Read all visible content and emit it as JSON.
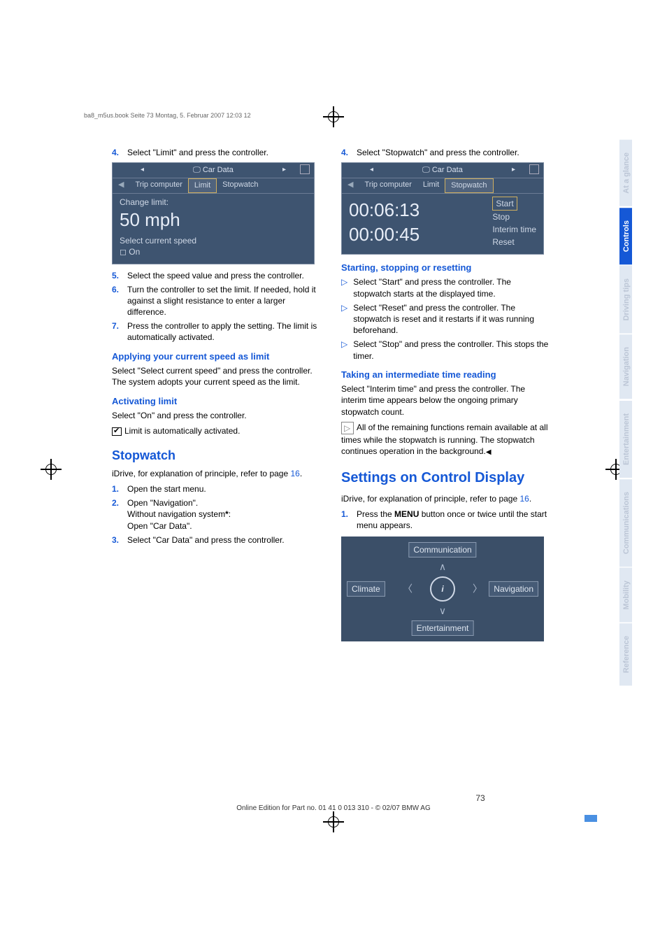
{
  "header_running": "ba8_m5us.book  Seite 73  Montag, 5. Februar 2007  12:03 12",
  "left": {
    "step4": "Select \"Limit\" and press the controller.",
    "shot1": {
      "title": "Car Data",
      "tab1": "Trip computer",
      "tab2": "Limit",
      "tab3": "Stopwatch",
      "line1": "Change limit:",
      "big": "50 mph",
      "line2": "Select current speed",
      "line3": "On"
    },
    "step5": "Select the speed value and press the controller.",
    "step6": "Turn the controller to set the limit. If needed, hold it against a slight resistance to enter a larger difference.",
    "step7": "Press the controller to apply the setting. The limit is automatically activated.",
    "h_apply": "Applying your current speed as limit",
    "p_apply": "Select \"Select current speed\" and press the controller. The system adopts your current speed as the limit.",
    "h_act": "Activating limit",
    "p_act1": "Select \"On\" and press the controller.",
    "p_act2": "Limit is automatically activated.",
    "h_stopwatch": "Stopwatch",
    "p_idrive": "iDrive, for explanation of principle, refer to page ",
    "pglink": "16",
    "s1": "Open the start menu.",
    "s2a": "Open \"Navigation\".",
    "s2b": "Without navigation system",
    "s2c": "Open \"Car Data\".",
    "s3": "Select \"Car Data\" and press the controller."
  },
  "right": {
    "step4": "Select \"Stopwatch\" and press the controller.",
    "shot2": {
      "title": "Car Data",
      "tab1": "Trip computer",
      "tab2": "Limit",
      "tab3": "Stopwatch",
      "t1": "00:06:13",
      "t2": "00:00:45",
      "o1": "Start",
      "o2": "Stop",
      "o3": "Interim time",
      "o4": "Reset"
    },
    "h_start": "Starting, stopping or resetting",
    "b1": "Select \"Start\" and press the controller. The stopwatch starts at the displayed time.",
    "b2": "Select \"Reset\" and press the controller. The stopwatch is reset and it restarts if it was running beforehand.",
    "b3": "Select \"Stop\" and press the controller. This stops the timer.",
    "h_interim": "Taking an intermediate time reading",
    "p_interim": "Select \"Interim time\" and press the controller. The interim time appears below the ongoing primary stopwatch count.",
    "note": "All of the remaining functions remain available at all times while the stopwatch is running. The stopwatch continues operation in the background.",
    "h_settings": "Settings on Control Display",
    "p_idrive": "iDrive, for explanation of principle, refer to page ",
    "pglink": "16",
    "s1a": "Press the ",
    "menu": "MENU",
    "s1b": " button once or twice until the start menu appears.",
    "menushot": {
      "top": "Communication",
      "bottom": "Entertainment",
      "left": "Climate",
      "right": "Navigation",
      "center": "i"
    }
  },
  "sidetabs": [
    "At a glance",
    "Controls",
    "Driving tips",
    "Navigation",
    "Entertainment",
    "Communications",
    "Mobility",
    "Reference"
  ],
  "page_number": "73",
  "footer": "Online Edition for Part no. 01 41 0 013 310 - © 02/07 BMW AG"
}
